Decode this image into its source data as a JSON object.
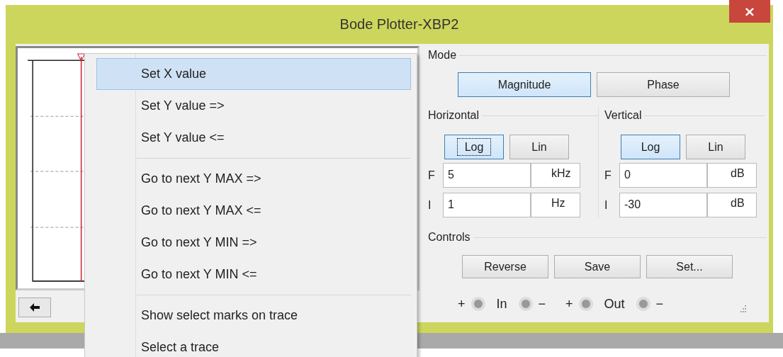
{
  "window": {
    "title": "Bode Plotter-XBP2",
    "close": "×"
  },
  "mode": {
    "label": "Mode",
    "buttons": [
      {
        "label": "Magnitude",
        "selected": true
      },
      {
        "label": "Phase",
        "selected": false
      }
    ]
  },
  "axes": [
    {
      "label": "Horizontal",
      "scales": [
        {
          "label": "Log",
          "selected": true,
          "focused": true
        },
        {
          "label": "Lin",
          "selected": false,
          "focused": false
        }
      ],
      "fields": [
        {
          "letter": "F",
          "value": "5",
          "unit": "kHz"
        },
        {
          "letter": "I",
          "value": "1",
          "unit": "Hz"
        }
      ]
    },
    {
      "label": "Vertical",
      "scales": [
        {
          "label": "Log",
          "selected": true,
          "focused": false
        },
        {
          "label": "Lin",
          "selected": false,
          "focused": false
        }
      ],
      "fields": [
        {
          "letter": "F",
          "value": "0",
          "unit": "dB"
        },
        {
          "letter": "I",
          "value": "-30",
          "unit": "dB"
        }
      ]
    }
  ],
  "controls": {
    "label": "Controls",
    "buttons": [
      "Reverse",
      "Save",
      "Set..."
    ]
  },
  "terminals": [
    {
      "plus": "+",
      "label": "In",
      "minus": "−"
    },
    {
      "plus": "+",
      "label": "Out",
      "minus": "−"
    }
  ],
  "menu": [
    {
      "kind": "item",
      "label": "Set X value",
      "selected": true
    },
    {
      "kind": "item",
      "label": "Set Y value =>",
      "selected": false
    },
    {
      "kind": "item",
      "label": "Set Y value <=",
      "selected": false
    },
    {
      "kind": "separator"
    },
    {
      "kind": "item",
      "label": "Go to next Y MAX =>",
      "selected": false
    },
    {
      "kind": "item",
      "label": "Go to next Y MAX <=",
      "selected": false
    },
    {
      "kind": "item",
      "label": "Go to next Y MIN =>",
      "selected": false
    },
    {
      "kind": "item",
      "label": "Go to next Y MIN <=",
      "selected": false
    },
    {
      "kind": "separator"
    },
    {
      "kind": "item",
      "label": "Show select marks on trace",
      "selected": false
    },
    {
      "kind": "item",
      "label": "Select a trace",
      "selected": false
    }
  ]
}
